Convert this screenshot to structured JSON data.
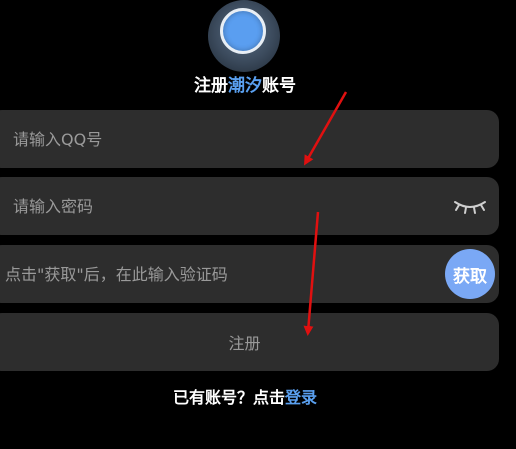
{
  "header": {
    "title_prefix": "注册",
    "title_brand": "潮汐",
    "title_suffix": "账号"
  },
  "form": {
    "qq_placeholder": "请输入QQ号",
    "qq_value": "",
    "password_placeholder": "请输入密码",
    "password_value": "",
    "code_placeholder": "点击\"获取\"后，在此输入验证码",
    "code_value": "",
    "get_code_label": "获取",
    "register_label": "注册"
  },
  "footer": {
    "prompt": "已有账号？点击",
    "login_label": "登录"
  },
  "icons": {
    "logo": "app-logo-icon",
    "eye": "eye-closed-icon"
  },
  "colors": {
    "background": "#000000",
    "field_bg": "#2d2d2d",
    "accent": "#5aa0f0",
    "get_code_bg": "#7aa8f5",
    "annotation_arrow": "#e01010"
  }
}
